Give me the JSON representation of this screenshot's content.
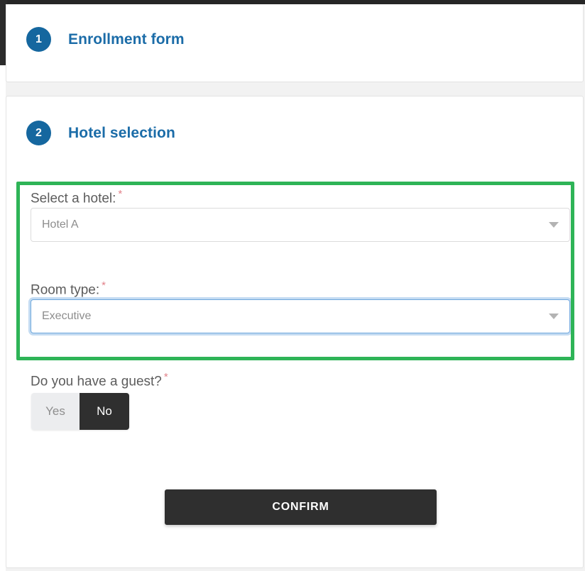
{
  "window": {
    "background_color": "#ffffff",
    "page_background_color": "#f2f2f2"
  },
  "theme": {
    "accent_blue": "#15679f",
    "title_blue": "#1b6ca8",
    "highlight_green": "#2eb457",
    "focus_blue": "#6fa8dc",
    "dark_button": "#2f2f2f",
    "required_star": "#e2828a"
  },
  "steps": [
    {
      "number": "1",
      "title": "Enrollment form"
    },
    {
      "number": "2",
      "title": "Hotel selection"
    }
  ],
  "form": {
    "hotel": {
      "label": "Select a hotel:",
      "required_marker": "*",
      "value": "Hotel A",
      "caret_icon": "chevron-down-icon"
    },
    "room_type": {
      "label": "Room type:",
      "required_marker": "*",
      "value": "Executive",
      "caret_icon": "chevron-down-icon",
      "focused": true
    },
    "guest": {
      "label": "Do you have a guest?",
      "required_marker": "*",
      "options": [
        {
          "label": "Yes",
          "selected": false
        },
        {
          "label": "No",
          "selected": true
        }
      ]
    },
    "confirm_label": "CONFIRM"
  }
}
